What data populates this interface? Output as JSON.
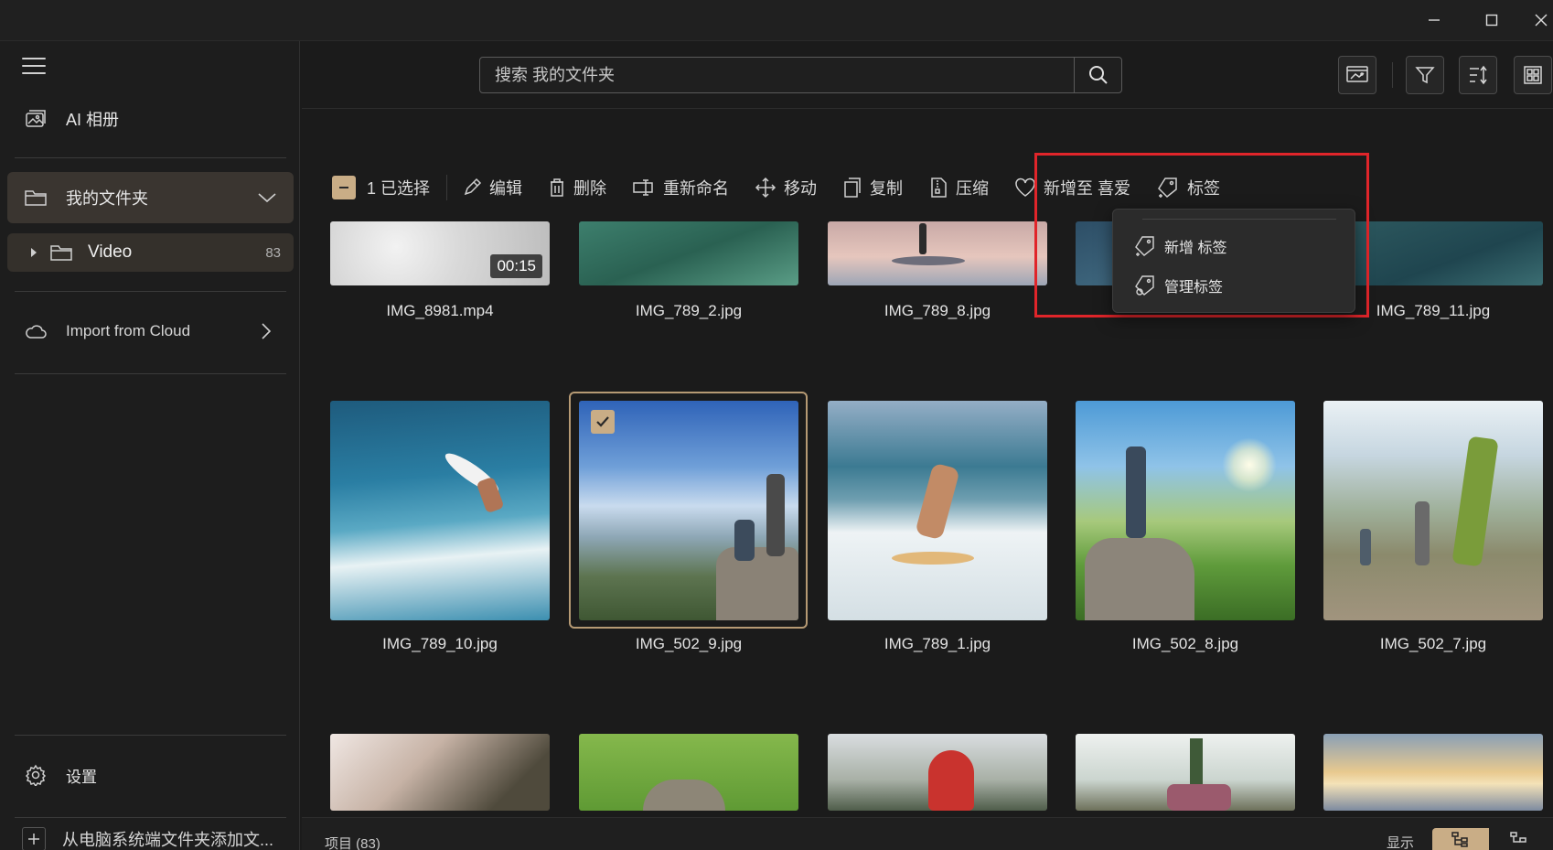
{
  "window": {
    "minimize": "—",
    "maximize": "☐",
    "close": "✕"
  },
  "sidebar": {
    "ai_album": "AI 相册",
    "my_folder": "我的文件夹",
    "video_folder": {
      "label": "Video",
      "count": "83"
    },
    "import_cloud": "Import from Cloud",
    "settings": "设置",
    "add_folder": "从电脑系统端文件夹添加文..."
  },
  "search": {
    "placeholder": "搜索 我的文件夹"
  },
  "toolbar": {
    "selected": "1 已选择",
    "edit": "编辑",
    "delete": "删除",
    "rename": "重新命名",
    "move": "移动",
    "copy": "复制",
    "compress": "压缩",
    "add_favorite": "新增至 喜爱",
    "tag": "标签"
  },
  "tag_menu": {
    "new_tag": "新增 标签",
    "manage_tag": "管理标签"
  },
  "grid": {
    "row1": [
      "IMG_8981.mp4",
      "IMG_789_2.jpg",
      "IMG_789_8.jpg",
      "",
      "IMG_789_11.jpg"
    ],
    "row1_duration": "00:15",
    "row2": [
      "IMG_789_10.jpg",
      "IMG_502_9.jpg",
      "IMG_789_1.jpg",
      "IMG_502_8.jpg",
      "IMG_502_7.jpg"
    ]
  },
  "footer": {
    "items_count": "项目 (83)",
    "display": "显示"
  },
  "colors": {
    "accent": "#c9ad86",
    "highlight": "#e0252a",
    "background": "#1b1b1b"
  }
}
